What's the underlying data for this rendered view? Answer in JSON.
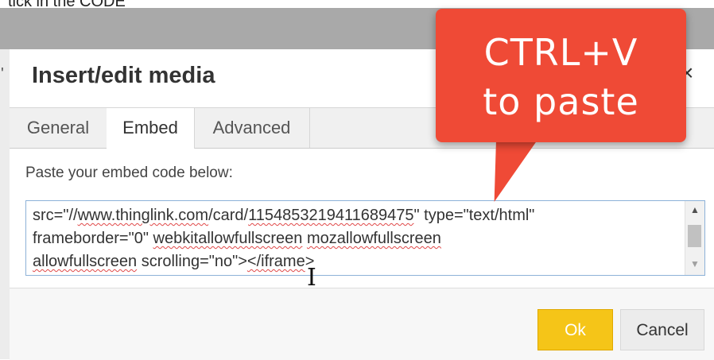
{
  "background_partial_text": "tick in the CODE",
  "dialog": {
    "title": "Insert/edit media",
    "close_glyph": "×",
    "tabs": [
      {
        "label": "General",
        "active": false
      },
      {
        "label": "Embed",
        "active": true
      },
      {
        "label": "Advanced",
        "active": false
      }
    ],
    "embed_label": "Paste your embed code below:",
    "embed_code": {
      "line1_a": "src=\"//",
      "line1_b": "www.thinglink.com",
      "line1_c": "/card/",
      "line1_d": "1154853219411689475",
      "line1_e": "\" type=\"text/html\"",
      "line2_a": "frameborder=\"0\" ",
      "line2_b": "webkitallowfullscreen",
      "line2_c": " ",
      "line2_d": "mozallowfullscreen",
      "line3_a": "allowfullscreen",
      "line3_b": " scrolling=\"no\">",
      "line3_c": "</iframe",
      "line3_d": ">"
    },
    "buttons": {
      "ok": "Ok",
      "cancel": "Cancel"
    }
  },
  "callout": {
    "line1": "CTRL+V",
    "line2": "to paste"
  },
  "icons": {
    "scroll_up": "▲",
    "scroll_down": "▼",
    "text_cursor": "I"
  },
  "colors": {
    "accent_ok": "#f5c518",
    "callout": "#ef4a36",
    "spellcheck": "#e04848"
  }
}
